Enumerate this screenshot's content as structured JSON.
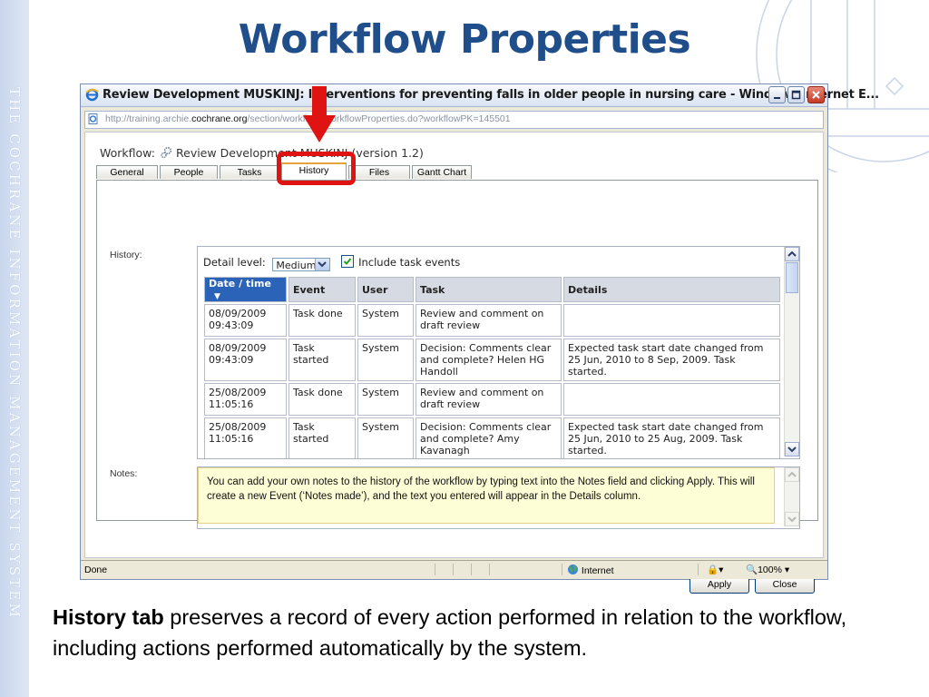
{
  "slide": {
    "title": "Workflow Properties",
    "side_text": "THE COCHRANE INFORMATION MANAGEMENT SYSTEM",
    "caption_bold": "History tab",
    "caption_rest": " preserves a record of every action performed in relation to the workflow, including actions performed automatically by the system."
  },
  "window": {
    "title": "Review Development MUSKINJ: Interventions for preventing falls in older people in nursing care  - Windows Internet E...",
    "url_prefix": "http://training.archie.",
    "url_domain": "cochrane.org",
    "url_rest": "/section/workflow/WorkflowProperties.do?workflowPK=145501"
  },
  "workflow": {
    "label": "Workflow:",
    "name": "Review Development MUSKINJ (version 1.2)"
  },
  "tabs": [
    {
      "label": "General"
    },
    {
      "label": "People"
    },
    {
      "label": "Tasks"
    },
    {
      "label": "History"
    },
    {
      "label": "Files"
    },
    {
      "label": "Gantt Chart"
    }
  ],
  "history": {
    "label": "History:",
    "detail_level_label": "Detail level:",
    "detail_level_value": "Medium",
    "include_task_events_label": "Include task events",
    "include_task_events_checked": true,
    "columns": [
      "Date / time",
      "Event",
      "User",
      "Task",
      "Details"
    ],
    "rows": [
      {
        "date": "08/09/2009",
        "time": "09:43:09",
        "event": "Task done",
        "user": "System",
        "task": "Review and comment on draft review",
        "details": ""
      },
      {
        "date": "08/09/2009",
        "time": "09:43:09",
        "event": "Task started",
        "user": "System",
        "task": "Decision: Comments clear and complete? Helen HG Handoll",
        "details": "Expected task start date changed from 25 Jun, 2010 to 8 Sep, 2009. Task started."
      },
      {
        "date": "25/08/2009",
        "time": "11:05:16",
        "event": "Task done",
        "user": "System",
        "task": "Review and comment on draft review",
        "details": ""
      },
      {
        "date": "25/08/2009",
        "time": "11:05:16",
        "event": "Task started",
        "user": "System",
        "task": "Decision: Comments clear and complete? Amy Kavanagh",
        "details": "Expected task start date changed from 25 Jun, 2010 to 25 Aug, 2009. Task started."
      }
    ]
  },
  "notes": {
    "label": "Notes:",
    "tooltip": "You can add your own notes to the history of the workflow by typing text into the Notes field and clicking Apply. This will create a new Event (‘Notes made’), and the text you entered will appear in the Details column."
  },
  "buttons": {
    "apply": "Apply",
    "close": "Close"
  },
  "statusbar": {
    "status": "Done",
    "zone": "Internet",
    "zoom": "100%"
  },
  "colors": {
    "title_blue": "#1f4e8a",
    "highlight_red": "#e01313",
    "sorted_header": "#2b63b8"
  }
}
